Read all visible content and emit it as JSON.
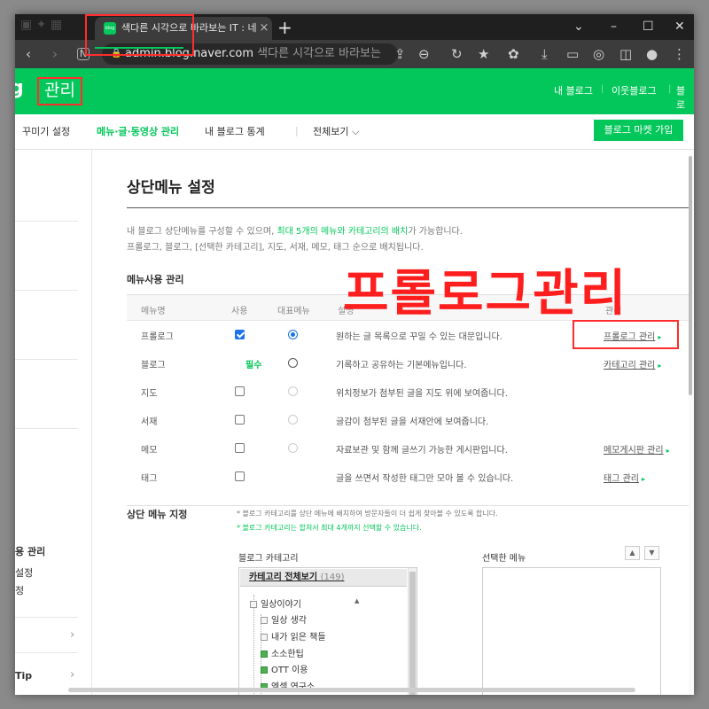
{
  "browser": {
    "tab_title": "색다른 시각으로 바라보는 IT : 네",
    "tab_favicon": "blog",
    "tab_close": "×",
    "new_tab": "+",
    "window_controls": [
      "⌄",
      "–",
      "☐",
      "✕"
    ],
    "url_domain": "admin.blog.naver.com",
    "url_page_title": "색다른 시각으로 바라보는",
    "lock": "🔒"
  },
  "header": {
    "logo_fragment": "g",
    "admin_title": "관리",
    "nav": [
      "내 블로그",
      "이웃블로그",
      "블로"
    ]
  },
  "subnav": {
    "items": [
      "꾸미기 설정",
      "메뉴·글·동영상 관리",
      "내 블로그 통계",
      "|",
      "전체보기 ⌵"
    ],
    "market_button": "블로그 마켓 가입"
  },
  "sidebar": {
    "items": [
      "ᅟ 관리",
      "설정",
      "정"
    ],
    "item_active": "용 관리",
    "item_2": "설정",
    "item_3": "정",
    "item_tip": "Tip",
    "chevron": "›"
  },
  "main": {
    "page_title": "상단메뉴 설정",
    "desc_line1_a": "내 블로그 상단메뉴를 구성할 수 있으며, ",
    "desc_line1_b": "최대 5개의 메뉴와 카테고리의 배치",
    "desc_line1_c": "가 가능합니다.",
    "desc_line2": "프롤로그, 블로그, [선택한 카테고리], 지도, 서재, 메모, 태그 순으로 배치됩니다.",
    "section_usage": "메뉴사용 관리",
    "annotation": "프롤로그관리",
    "table_headers": [
      "메뉴명",
      "사용",
      "대표메뉴",
      "설명",
      "관리"
    ],
    "rows": [
      {
        "name": "프롤로그",
        "desc": "원하는 글 목록으로 꾸밀 수 있는 대문입니다.",
        "link": "프롤로그 관리",
        "use": true,
        "rep": "on"
      },
      {
        "name": "블로그",
        "desc": "기록하고 공유하는 기본메뉴입니다.",
        "link": "카테고리 관리",
        "required": "필수",
        "rep": "off-active"
      },
      {
        "name": "지도",
        "desc": "위치정보가 첨부된 글을 지도 위에 보여줍니다.",
        "link": "",
        "use": false,
        "rep": "disabled"
      },
      {
        "name": "서재",
        "desc": "글감이 첨부된 글을 서재안에 보여줍니다.",
        "link": "",
        "use": false,
        "rep": "disabled"
      },
      {
        "name": "메모",
        "desc": "자료보관 및 함께 글쓰기 가능한 게시판입니다.",
        "link": "메모게시판 관리",
        "use": false,
        "rep": "disabled"
      },
      {
        "name": "태그",
        "desc": "글을 쓰면서 작성한 태그만 모아 볼 수 있습니다.",
        "link": "태그 관리",
        "use": false,
        "rep": "none"
      }
    ],
    "section_assign": "상단 메뉴 지정",
    "note1": "* 블로그 카테고리를 상단 메뉴에 배치하여 방문자들이 더 쉽게 찾아볼 수 있도록 합니다.",
    "note2": "* 블로그 카테고리는 합쳐서 최대 4개까지 선택할 수 있습니다.",
    "blog_category_label": "블로그 카테고리",
    "selected_menu_label": "선택한 메뉴",
    "tree_head": "카테고리 전체보기",
    "tree_count": "(149)",
    "tree_items": [
      "일상이야기",
      "일상 생각",
      "내가 읽은 책들",
      "소소한팁",
      "OTT 이용",
      "엑셀 연구소"
    ],
    "up_arrow": "▲",
    "down_arrow": "▼"
  },
  "colors": {
    "naver_green": "#03c75a",
    "annotation_red": "#ff1e1e"
  }
}
